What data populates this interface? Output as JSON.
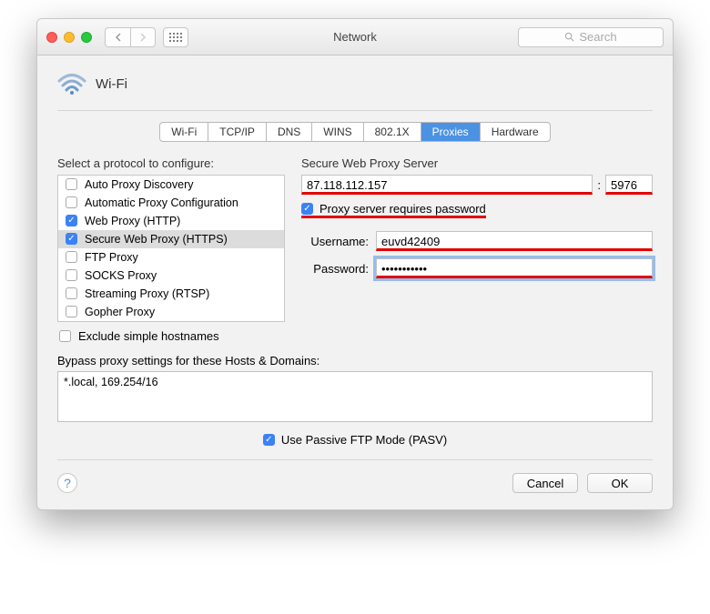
{
  "window": {
    "title": "Network"
  },
  "search": {
    "placeholder": "Search"
  },
  "header": {
    "interface": "Wi-Fi"
  },
  "tabs": [
    "Wi-Fi",
    "TCP/IP",
    "DNS",
    "WINS",
    "802.1X",
    "Proxies",
    "Hardware"
  ],
  "active_tab_index": 5,
  "left": {
    "label": "Select a protocol to configure:",
    "protocols": [
      {
        "label": "Auto Proxy Discovery",
        "checked": false
      },
      {
        "label": "Automatic Proxy Configuration",
        "checked": false
      },
      {
        "label": "Web Proxy (HTTP)",
        "checked": true
      },
      {
        "label": "Secure Web Proxy (HTTPS)",
        "checked": true
      },
      {
        "label": "FTP Proxy",
        "checked": false
      },
      {
        "label": "SOCKS Proxy",
        "checked": false
      },
      {
        "label": "Streaming Proxy (RTSP)",
        "checked": false
      },
      {
        "label": "Gopher Proxy",
        "checked": false
      }
    ],
    "selected_index": 3,
    "exclude_label": "Exclude simple hostnames",
    "exclude_checked": false
  },
  "right": {
    "server_label": "Secure Web Proxy Server",
    "server_host": "87.118.112.157",
    "server_port": "5976",
    "colon": ":",
    "auth_checked": true,
    "auth_label": "Proxy server requires password",
    "username_label": "Username:",
    "username_value": "euvd42409",
    "password_label": "Password:",
    "password_value": "•••••••••••"
  },
  "bypass": {
    "label": "Bypass proxy settings for these Hosts & Domains:",
    "value": "*.local, 169.254/16"
  },
  "pasv": {
    "label": "Use Passive FTP Mode (PASV)",
    "checked": true
  },
  "footer": {
    "cancel": "Cancel",
    "ok": "OK"
  }
}
